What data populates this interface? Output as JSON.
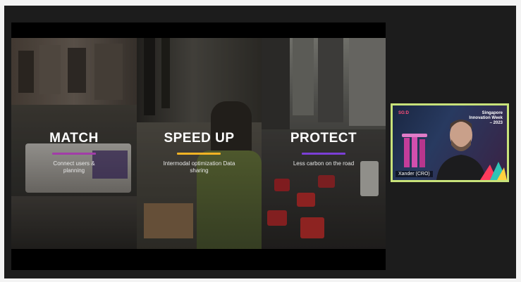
{
  "slide": {
    "panels": [
      {
        "heading": "MATCH",
        "subtitle": "Connect users & planning",
        "accent": "#a23ca8"
      },
      {
        "heading": "SPEED UP",
        "subtitle": "Intermodal optimization Data sharing",
        "accent": "#f5b324"
      },
      {
        "heading": "PROTECT",
        "subtitle": "Less carbon on the road",
        "accent": "#7b3fd6"
      }
    ]
  },
  "participant": {
    "name": "Xander (CRO)",
    "background_title": "Singapore Innovation Week – 2023",
    "background_logo": "SG:D"
  },
  "colors": {
    "meeting_bg": "#1c1c1c",
    "active_speaker_border": "#c8e27a"
  }
}
